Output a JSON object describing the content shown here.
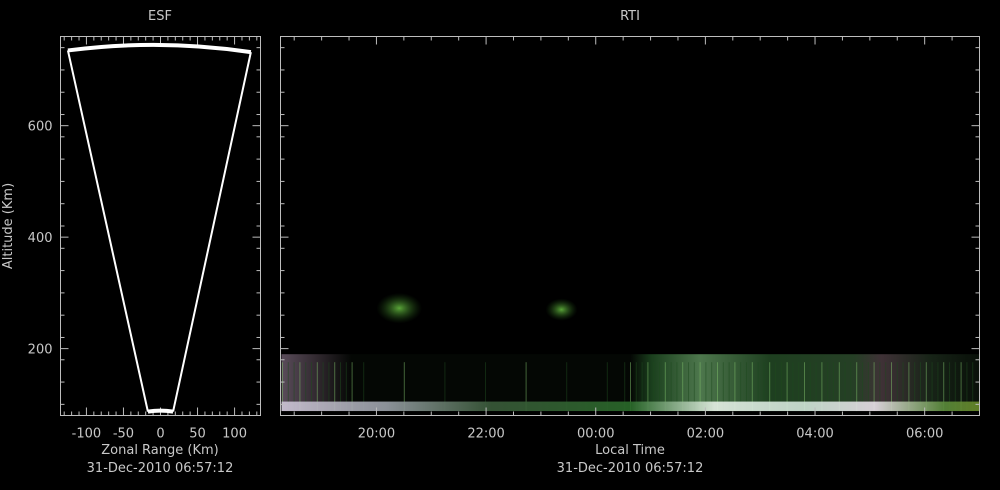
{
  "chart_data": [
    {
      "type": "scatter",
      "title": "ESF",
      "xlabel": "Zonal Range (Km)",
      "ylabel": "Altitude (Km)",
      "timestamp": "31-Dec-2010 06:57:12",
      "xlim": [
        -135,
        135
      ],
      "ylim": [
        80,
        760
      ],
      "x_ticks": [
        -100,
        -50,
        0,
        50,
        100
      ],
      "y_ticks": [
        200,
        400,
        600
      ],
      "beam_outline": {
        "color": "#ffffff",
        "left_edge": [
          [
            -17,
            87
          ],
          [
            -125,
            735
          ]
        ],
        "right_edge": [
          [
            17,
            87
          ],
          [
            122,
            732
          ]
        ]
      }
    },
    {
      "type": "heatmap",
      "title": "RTI",
      "xlabel": "Local Time",
      "timestamp": "31-Dec-2010 06:57:12",
      "xlim": [
        "18:15",
        "07:00"
      ],
      "ylim": [
        80,
        760
      ],
      "x_ticks": [
        "20:00",
        "22:00",
        "00:00",
        "02:00",
        "04:00",
        "06:00"
      ],
      "y_ticks": [
        200,
        400,
        600
      ],
      "echo_regions": [
        {
          "name": "plume-1",
          "time": [
            "20:00",
            "20:50"
          ],
          "alt": [
            245,
            300
          ],
          "color": "#3d8a2a"
        },
        {
          "name": "plume-2",
          "time": [
            "23:05",
            "23:40"
          ],
          "alt": [
            250,
            290
          ],
          "color": "#3d8a2a"
        },
        {
          "name": "lower-layer",
          "time": [
            "18:15",
            "07:00"
          ],
          "alt": [
            88,
            190
          ],
          "color": "#2e6e2a"
        },
        {
          "name": "bottom-layer",
          "time": [
            "18:15",
            "07:00"
          ],
          "alt": [
            88,
            105
          ],
          "color": "#e8e8f0"
        }
      ]
    }
  ]
}
